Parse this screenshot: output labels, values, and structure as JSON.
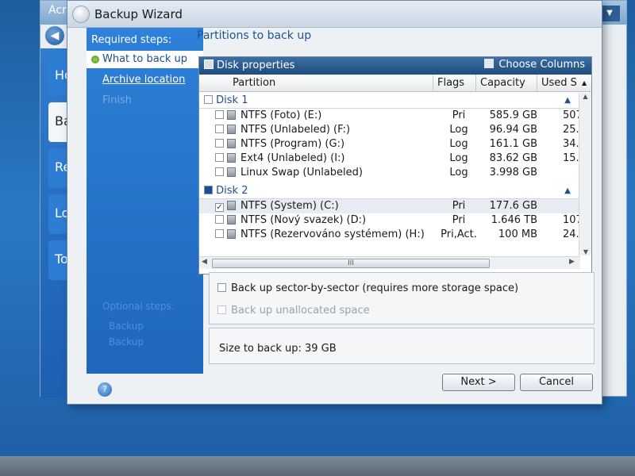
{
  "background_app": {
    "title": "Acro",
    "tiles": [
      "Ho",
      "Ba",
      "Re",
      "Lo",
      "To"
    ]
  },
  "wizard": {
    "title": "Backup Wizard",
    "required_steps_heading": "Required steps:",
    "steps": [
      {
        "label": "What to back up",
        "state": "current"
      },
      {
        "label": "Archive location",
        "state": "link"
      },
      {
        "label": "Finish",
        "state": "disabled"
      }
    ],
    "optional_steps_heading": "Optional steps:",
    "optional_steps": [
      "Backup",
      "Backup"
    ],
    "page_title": "Partitions to back up",
    "panel": {
      "title": "Disk properties",
      "choose_columns": "Choose Columns",
      "columns": {
        "partition": "Partition",
        "flags": "Flags",
        "capacity": "Capacity",
        "used": "Used S"
      },
      "disks": [
        {
          "label": "Disk 1",
          "checked": false,
          "partitions": [
            {
              "name": "NTFS (Foto) (E:)",
              "flags": "Pri",
              "capacity": "585.9 GB",
              "used": "507",
              "checked": false
            },
            {
              "name": "NTFS (Unlabeled) (F:)",
              "flags": "Log",
              "capacity": "96.94 GB",
              "used": "25.",
              "checked": false
            },
            {
              "name": "NTFS (Program) (G:)",
              "flags": "Log",
              "capacity": "161.1 GB",
              "used": "34.",
              "checked": false
            },
            {
              "name": "Ext4 (Unlabeled) (I:)",
              "flags": "Log",
              "capacity": "83.62 GB",
              "used": "15.",
              "checked": false
            },
            {
              "name": "Linux Swap (Unlabeled)",
              "flags": "Log",
              "capacity": "3.998 GB",
              "used": "",
              "checked": false
            }
          ]
        },
        {
          "label": "Disk 2",
          "checked": "partial",
          "partitions": [
            {
              "name": "NTFS (System) (C:)",
              "flags": "Pri",
              "capacity": "177.6 GB",
              "used": "",
              "checked": true
            },
            {
              "name": "NTFS (Nový svazek) (D:)",
              "flags": "Pri",
              "capacity": "1.646 TB",
              "used": "107",
              "checked": false
            },
            {
              "name": "NTFS (Rezervováno systémem) (H:)",
              "flags": "Pri,Act.",
              "capacity": "100 MB",
              "used": "24.",
              "checked": false
            }
          ]
        }
      ],
      "hscroll_grip": "III"
    },
    "options": [
      {
        "label": "Back up sector-by-sector (requires more storage space)",
        "checked": false,
        "enabled": true
      },
      {
        "label": "Back up unallocated space",
        "checked": false,
        "enabled": false
      }
    ],
    "size_label": "Size to back up:",
    "size_value": "39 GB",
    "next_label": "Next >",
    "cancel_label": "Cancel"
  }
}
